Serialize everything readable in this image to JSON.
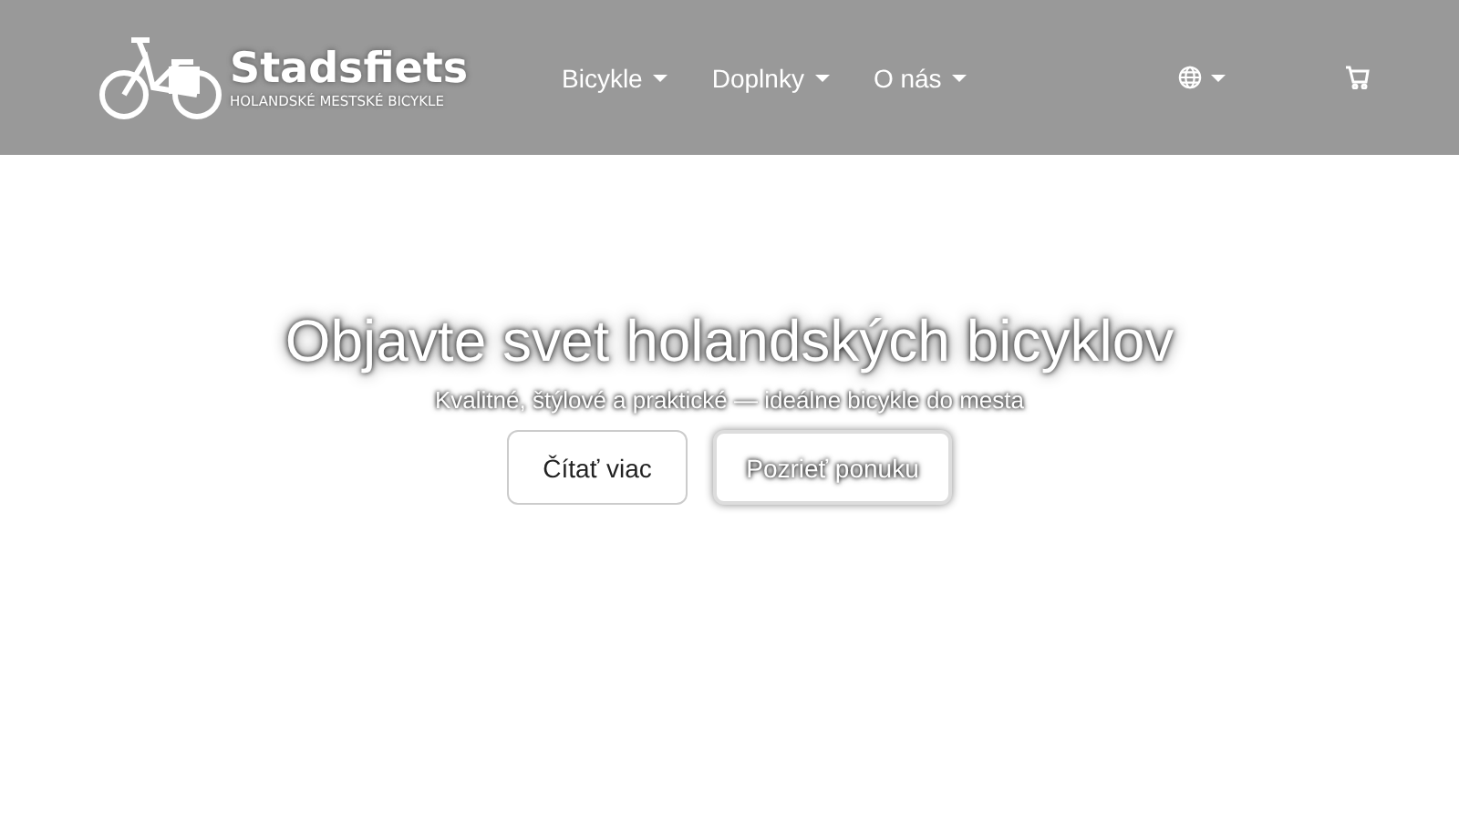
{
  "header": {
    "logo": {
      "name": "Stadsfiets",
      "tagline": "HOLANDSKÉ MESTSKÉ BICYKLE"
    },
    "nav": [
      {
        "label": "Bicykle"
      },
      {
        "label": "Doplnky"
      },
      {
        "label": "O nás"
      }
    ]
  },
  "hero": {
    "title": "Objavte svet holandských bicyklov",
    "subtitle": "Kvalitné, štýlové a praktické — ideálne bicykle do mesta",
    "buttons": [
      {
        "label": "Čítať viac",
        "kind": "plain"
      },
      {
        "label": "Pozrieť ponuku",
        "kind": "glow"
      }
    ]
  }
}
